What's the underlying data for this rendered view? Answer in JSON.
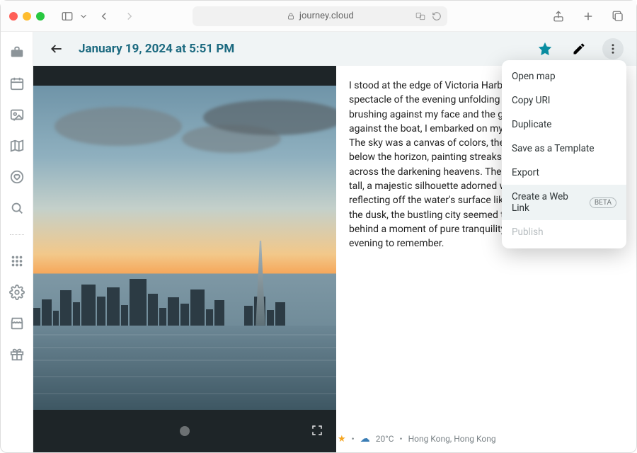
{
  "browser": {
    "url": "journey.cloud"
  },
  "header": {
    "title": "January 19, 2024 at 5:51 PM"
  },
  "entry": {
    "body": "I stood at the edge of Victoria Harbour, mesmerized by the spectacle of the evening unfolding before me. With the wind brushing against my face and the gentle waves lapping against the boat, I embarked on my sunset Star Ferry journey. The sky was a canvas of colors, the sun slowly descending below the horizon, painting streaks of orange, pink, and gold across the darkening heavens. The Hong Kong skyline stood tall, a majestic silhouette adorned with sparkling lights, reflecting off the water's surface like scattered diamonds. In the dusk, the bustling city seemed to fade away, leaving behind a moment of pure tranquility and awe. Truly, an evening to remember."
  },
  "menu": {
    "items": [
      {
        "label": "Open map",
        "state": "normal"
      },
      {
        "label": "Copy URI",
        "state": "normal"
      },
      {
        "label": "Duplicate",
        "state": "normal"
      },
      {
        "label": "Save as a Template",
        "state": "normal"
      },
      {
        "label": "Export",
        "state": "normal"
      },
      {
        "label": "Create a Web Link",
        "state": "hover",
        "badge": "BETA"
      },
      {
        "label": "Publish",
        "state": "disabled"
      }
    ]
  },
  "footer": {
    "temperature": "20°C",
    "location": "Hong Kong, Hong Kong",
    "separator": "•"
  },
  "sidebar": {
    "icons": [
      "briefcase",
      "calendar",
      "image",
      "map",
      "heart",
      "search",
      "grid",
      "gear",
      "store",
      "gift"
    ]
  }
}
